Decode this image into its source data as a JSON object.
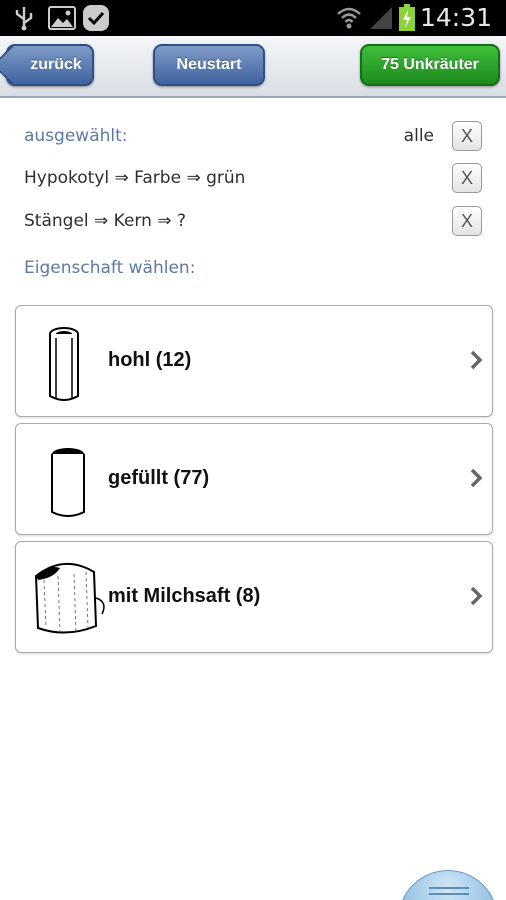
{
  "status_bar": {
    "time": "14:31",
    "icons": [
      "usb-icon",
      "image-icon",
      "check-icon",
      "wifi-icon",
      "signal-icon",
      "battery-charging-icon"
    ]
  },
  "action_bar": {
    "back_label": "zurück",
    "restart_label": "Neustart",
    "weeds_label": "75 Unkräuter"
  },
  "selection": {
    "label": "ausgewählt:",
    "all_label": "alle",
    "clear_symbol": "X",
    "criteria": [
      {
        "text": "Hypokotyl ⇒ Farbe ⇒ grün"
      },
      {
        "text": "Stängel ⇒ Kern ⇒ ?"
      }
    ]
  },
  "choose_label": "Eigenschaft wählen:",
  "options": [
    {
      "label": "hohl (12)",
      "icon": "hollow-stem-icon"
    },
    {
      "label": "gefüllt (77)",
      "icon": "filled-stem-icon"
    },
    {
      "label": "mit Milchsaft (8)",
      "icon": "milky-sap-stem-icon"
    }
  ],
  "colors": {
    "accent_blue": "#3f63a0",
    "accent_green": "#1d8a1d",
    "label_blue": "#5b7aa3"
  }
}
